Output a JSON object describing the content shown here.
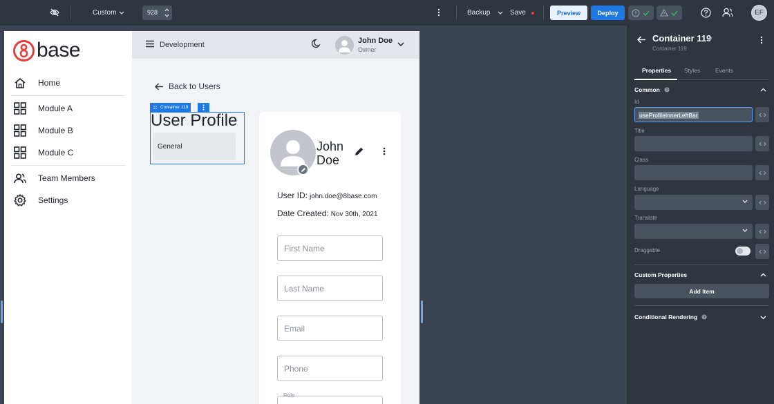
{
  "topbar": {
    "device_mode": "Custom",
    "width_value": "928",
    "backup_label": "Backup",
    "save_label": "Save",
    "preview_label": "Preview",
    "deploy_label": "Deploy",
    "user_initials": "EF",
    "save_dot_color": "#e53e3e",
    "check_color": "#22c55e"
  },
  "sidebar": {
    "logo_text": "base",
    "logo_digit": "8",
    "logo_color": "#e53e3e",
    "items": [
      {
        "label": "Home",
        "icon": "home-icon"
      },
      {
        "label": "Module A",
        "icon": "grid-icon"
      },
      {
        "label": "Module B",
        "icon": "grid-icon"
      },
      {
        "label": "Module C",
        "icon": "grid-icon"
      },
      {
        "label": "Team Members",
        "icon": "users-icon"
      },
      {
        "label": "Settings",
        "icon": "gear-icon"
      }
    ]
  },
  "app_header": {
    "app_name": "Development",
    "user_name": "John Doe",
    "user_role": "Owner"
  },
  "page": {
    "back_link": "Back to Users",
    "selected_tag": "Container 119",
    "left_title": "User Profile",
    "left_card_label": "General"
  },
  "profile": {
    "first_name_display": "John",
    "last_name_display": "Doe",
    "user_id_label": "User ID:",
    "user_id_value": "john.doe@8base.com",
    "date_label": "Date Created:",
    "date_value": "Nov 30th, 2021",
    "first_name_placeholder": "First Name",
    "last_name_placeholder": "Last Name",
    "email_placeholder": "Email",
    "phone_placeholder": "Phone",
    "role_label": "Role"
  },
  "panel": {
    "title": "Container 119",
    "subtitle": "Container 119",
    "tabs": [
      "Properties",
      "Styles",
      "Events"
    ],
    "active_tab": "Properties",
    "common_label": "Common",
    "fields": {
      "id_label": "Id",
      "id_value": "useProfileInnerLeftBar",
      "title_label": "Title",
      "class_label": "Class",
      "language_label": "Language",
      "translate_label": "Translate",
      "draggable_label": "Draggable"
    },
    "custom_properties_label": "Custom Properties",
    "add_item_label": "Add Item",
    "conditional_rendering_label": "Conditional Rendering"
  }
}
